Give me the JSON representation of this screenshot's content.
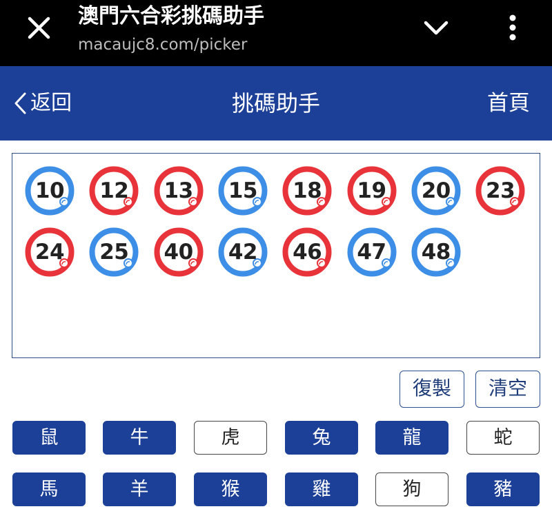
{
  "browser": {
    "page_name": "澳門六合彩挑碼助手",
    "url": "macaujc8.com/picker"
  },
  "header": {
    "back_label": "返回",
    "title": "挑碼助手",
    "home_label": "首頁"
  },
  "colors": {
    "header_bg": "#1c3f98",
    "red_ball": "#e8333a",
    "blue_ball": "#3d8ee6"
  },
  "selected_numbers": [
    {
      "number": "10",
      "color": "blue"
    },
    {
      "number": "12",
      "color": "red"
    },
    {
      "number": "13",
      "color": "red"
    },
    {
      "number": "15",
      "color": "blue"
    },
    {
      "number": "18",
      "color": "red"
    },
    {
      "number": "19",
      "color": "red"
    },
    {
      "number": "20",
      "color": "blue"
    },
    {
      "number": "23",
      "color": "red"
    },
    {
      "number": "24",
      "color": "red"
    },
    {
      "number": "25",
      "color": "blue"
    },
    {
      "number": "40",
      "color": "red"
    },
    {
      "number": "42",
      "color": "blue"
    },
    {
      "number": "46",
      "color": "red"
    },
    {
      "number": "47",
      "color": "blue"
    },
    {
      "number": "48",
      "color": "blue"
    }
  ],
  "actions": {
    "copy_label": "復製",
    "clear_label": "清空"
  },
  "zodiacs": [
    {
      "label": "鼠",
      "selected": true
    },
    {
      "label": "牛",
      "selected": true
    },
    {
      "label": "虎",
      "selected": false
    },
    {
      "label": "兔",
      "selected": true
    },
    {
      "label": "龍",
      "selected": true
    },
    {
      "label": "蛇",
      "selected": false
    },
    {
      "label": "馬",
      "selected": true
    },
    {
      "label": "羊",
      "selected": true
    },
    {
      "label": "猴",
      "selected": true
    },
    {
      "label": "雞",
      "selected": true
    },
    {
      "label": "狗",
      "selected": false
    },
    {
      "label": "豬",
      "selected": true
    }
  ]
}
